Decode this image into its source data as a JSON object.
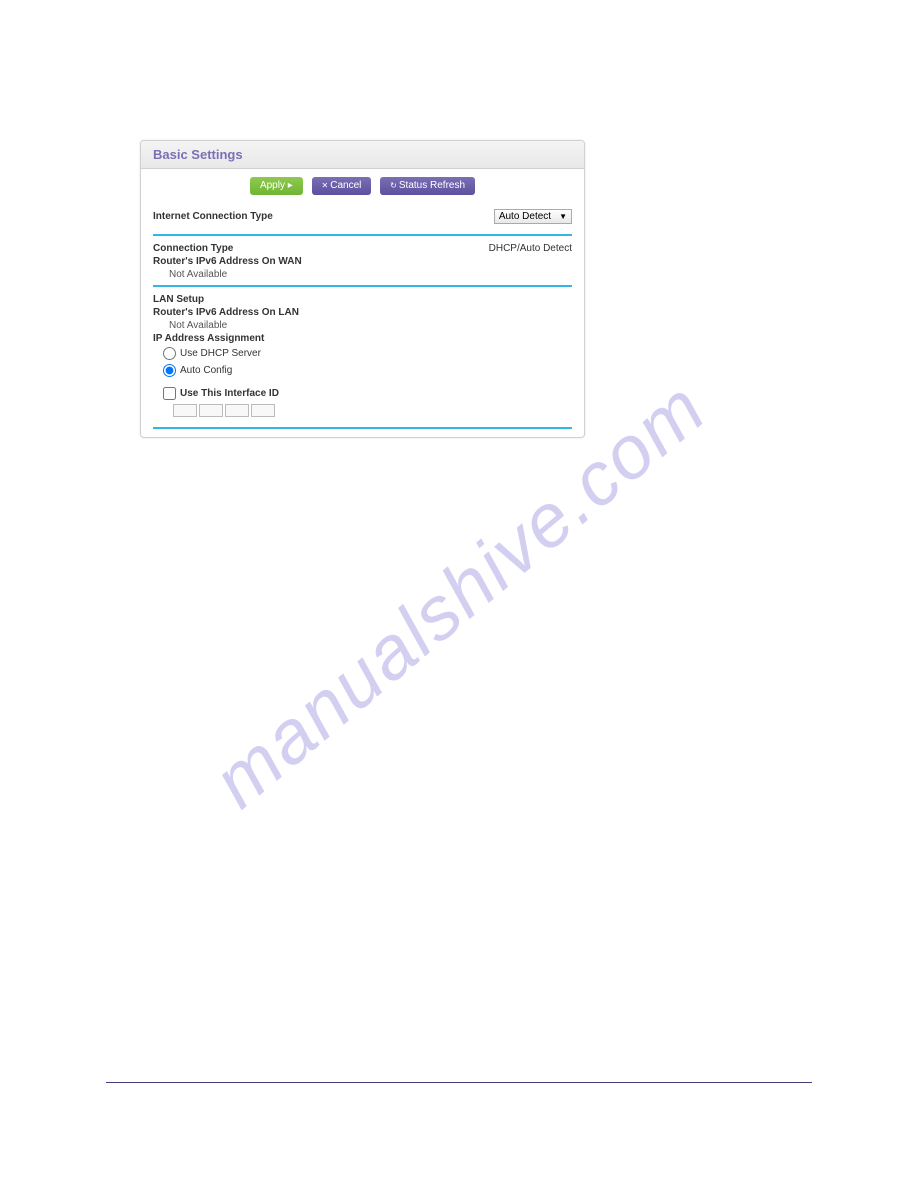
{
  "watermark": "manualshive.com",
  "panel": {
    "title": "Basic Settings",
    "buttons": {
      "apply": "Apply ▸",
      "cancel": "Cancel",
      "refresh": "Status Refresh"
    },
    "internet_section": {
      "title": "Internet Connection Type",
      "dropdown": "Auto Detect"
    },
    "connection": {
      "type_label": "Connection Type",
      "type_value": "DHCP/Auto Detect",
      "wan_label": "Router's IPv6 Address On WAN",
      "wan_value": "Not Available"
    },
    "lan": {
      "setup_label": "LAN Setup",
      "lan_label": "Router's IPv6 Address On LAN",
      "lan_value": "Not Available",
      "ip_assignment": "IP Address Assignment",
      "dhcp_option": "Use DHCP Server",
      "auto_option": "Auto Config",
      "interface_checkbox": "Use This Interface ID"
    }
  }
}
